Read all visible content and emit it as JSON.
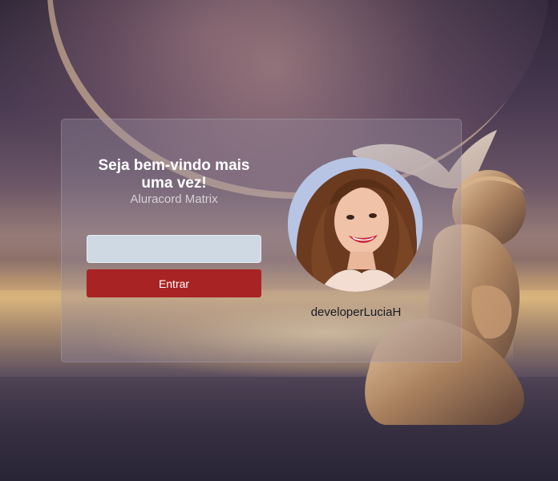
{
  "login": {
    "title": "Seja bem-vindo mais uma vez!",
    "subtitle": "Aluracord Matrix",
    "username_value": "",
    "button_label": "Entrar"
  },
  "profile": {
    "username": "developerLuciaH"
  },
  "colors": {
    "button": "#a82323",
    "input_bg": "#cfd9e3"
  }
}
